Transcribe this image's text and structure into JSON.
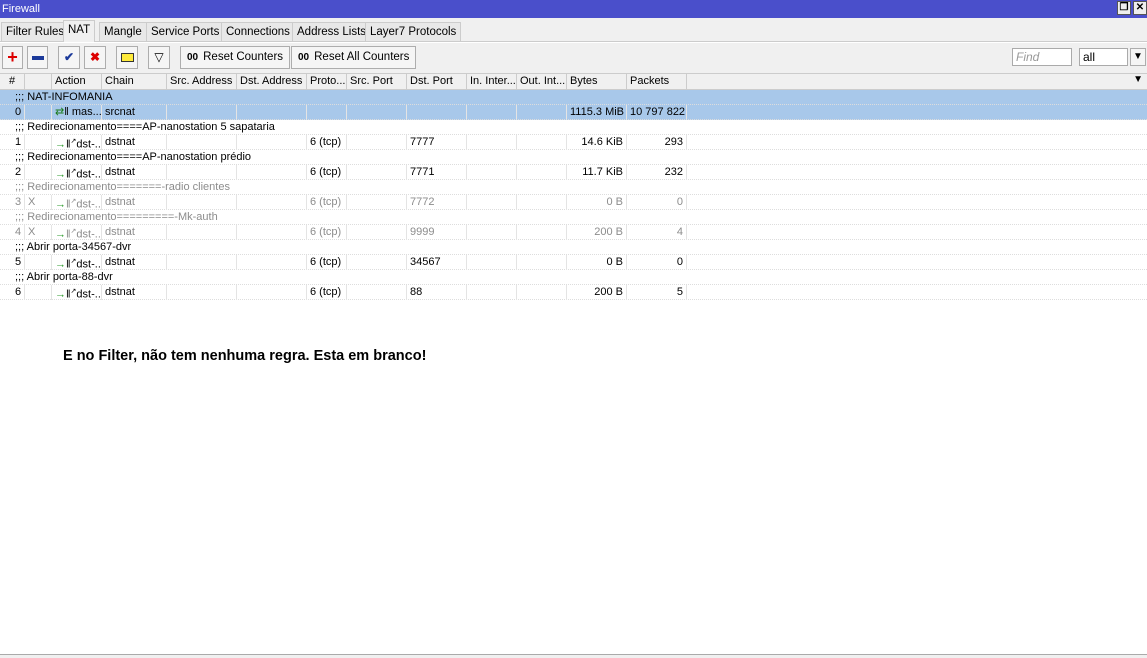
{
  "window": {
    "title": "Firewall",
    "restore": "❐",
    "close": "✕"
  },
  "tabs": [
    "Filter Rules",
    "NAT",
    "Mangle",
    "Service Ports",
    "Connections",
    "Address Lists",
    "Layer7 Protocols"
  ],
  "toolbar": {
    "reset_counters": "Reset Counters",
    "reset_all": "Reset All Counters",
    "counter_glyph": "00",
    "find_placeholder": "Find",
    "filter_value": "all"
  },
  "columns": [
    "#",
    "",
    "Action",
    "Chain",
    "Src. Address",
    "Dst. Address",
    "Proto...",
    "Src. Port",
    "Dst. Port",
    "In. Inter...",
    "Out. Int...",
    "Bytes",
    "Packets"
  ],
  "rules": [
    {
      "comment": ";;; NAT-INFOMANIA",
      "num": "0",
      "flag": "",
      "action": "mas...",
      "chain": "srcnat",
      "proto": "",
      "dst_port": "",
      "bytes": "1115.3 MiB",
      "packets": "10 797 822",
      "selected": true,
      "disabled": false
    },
    {
      "comment": ";;; Redirecionamento====AP-nanostation 5 sapataria",
      "num": "1",
      "flag": "",
      "action": "dst-...",
      "chain": "dstnat",
      "proto": "6 (tcp)",
      "dst_port": "7777",
      "bytes": "14.6 KiB",
      "packets": "293",
      "selected": false,
      "disabled": false
    },
    {
      "comment": ";;; Redirecionamento====AP-nanostation prédio",
      "num": "2",
      "flag": "",
      "action": "dst-...",
      "chain": "dstnat",
      "proto": "6 (tcp)",
      "dst_port": "7771",
      "bytes": "11.7 KiB",
      "packets": "232",
      "selected": false,
      "disabled": false
    },
    {
      "comment": ";;; Redirecionamento=======-radio clientes",
      "num": "3",
      "flag": "X",
      "action": "dst-...",
      "chain": "dstnat",
      "proto": "6 (tcp)",
      "dst_port": "7772",
      "bytes": "0 B",
      "packets": "0",
      "selected": false,
      "disabled": true
    },
    {
      "comment": ";;; Redirecionamento=========-Mk-auth",
      "num": "4",
      "flag": "X",
      "action": "dst-...",
      "chain": "dstnat",
      "proto": "6 (tcp)",
      "dst_port": "9999",
      "bytes": "200 B",
      "packets": "4",
      "selected": false,
      "disabled": true
    },
    {
      "comment": ";;; Abrir porta-34567-dvr",
      "num": "5",
      "flag": "",
      "action": "dst-...",
      "chain": "dstnat",
      "proto": "6 (tcp)",
      "dst_port": "34567",
      "bytes": "0 B",
      "packets": "0",
      "selected": false,
      "disabled": false
    },
    {
      "comment": ";;; Abrir porta-88-dvr",
      "num": "6",
      "flag": "",
      "action": "dst-...",
      "chain": "dstnat",
      "proto": "6 (tcp)",
      "dst_port": "88",
      "bytes": "200 B",
      "packets": "5",
      "selected": false,
      "disabled": false
    }
  ],
  "note": "E no Filter, não tem nenhuma regra. Esta em branco!"
}
